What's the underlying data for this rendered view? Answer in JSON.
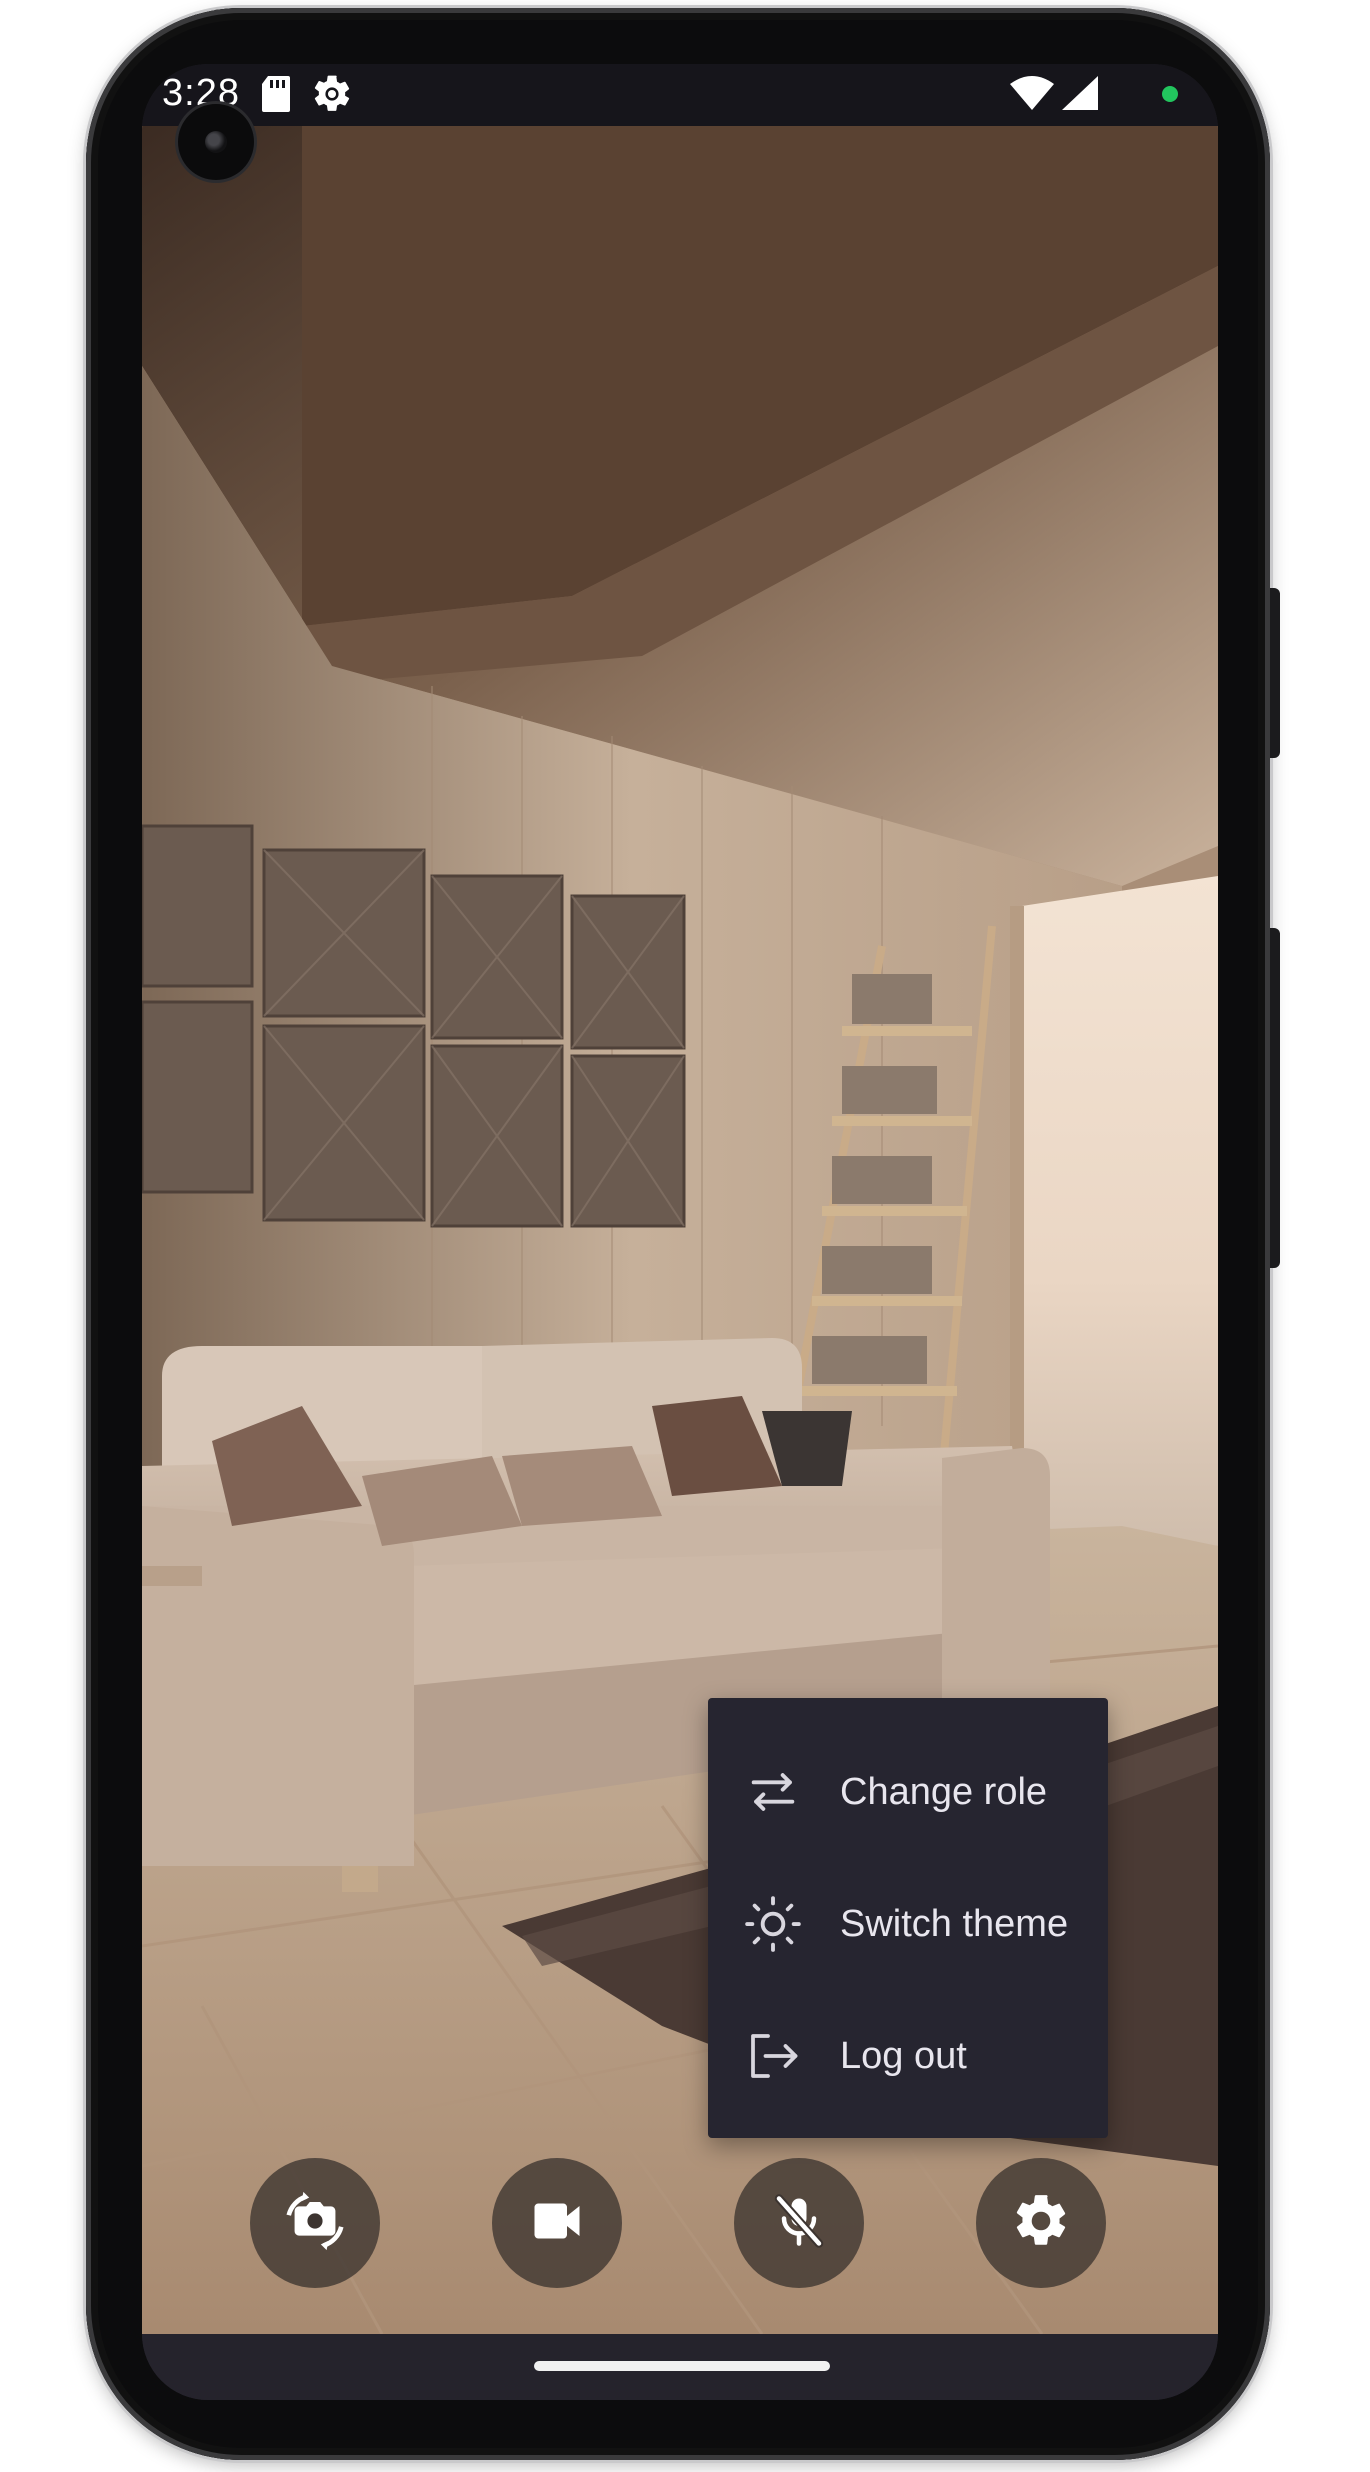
{
  "status_bar": {
    "time": "3:28",
    "icons": [
      "sd-card-icon",
      "settings-gear-icon",
      "wifi-icon",
      "cellular-signal-icon",
      "privacy-indicator-dot"
    ],
    "indicator_color": "#22c55e"
  },
  "menu": {
    "items": [
      {
        "label": "Change role",
        "icon": "swap-arrows-icon"
      },
      {
        "label": "Switch theme",
        "icon": "sun-icon"
      },
      {
        "label": "Log out",
        "icon": "logout-icon"
      }
    ]
  },
  "controls": [
    {
      "name": "switch-camera",
      "icon": "camera-flip-icon"
    },
    {
      "name": "video",
      "icon": "video-camera-icon"
    },
    {
      "name": "microphone",
      "icon": "mic-off-icon",
      "state": "muted"
    },
    {
      "name": "settings",
      "icon": "gear-icon"
    }
  ],
  "colors": {
    "menu_background": "#262530",
    "menu_text": "#e8e6ee",
    "control_background": "#3c3430",
    "system_bar": "#25232c"
  }
}
